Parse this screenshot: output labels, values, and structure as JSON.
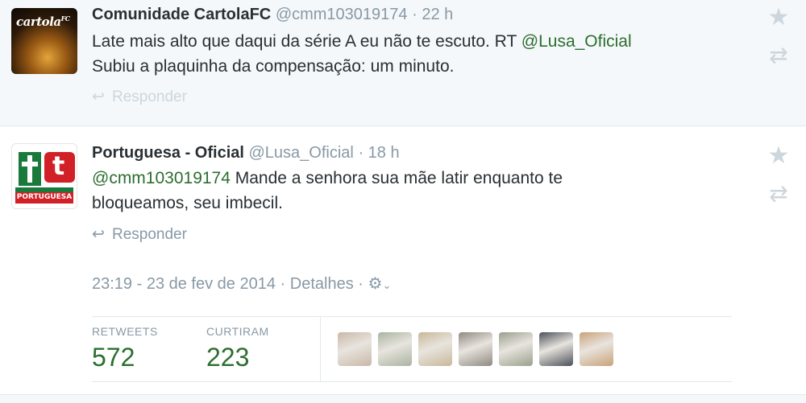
{
  "tweets": [
    {
      "avatar_text": "cartola",
      "avatar_sup": "FC",
      "fullname": "Comunidade CartolaFC",
      "handle": "@cmm103019174",
      "separator": "·",
      "time": "22 h",
      "body_line1_prefix": "Late mais alto que daqui da série A eu não te escuto. RT ",
      "body_line1_mention": "@Lusa_Oficial",
      "body_line2": "Subiu a plaquinha da compensação: um minuto.",
      "reply_label": "Responder"
    },
    {
      "avatar_caption": "PORTUGUESA",
      "fullname": "Portuguesa - Oficial",
      "handle": "@Lusa_Oficial",
      "separator": "·",
      "time": "18 h",
      "body_mention": "@cmm103019174",
      "body_line1_rest": " Mande a senhora sua mãe latir enquanto te",
      "body_line2": "bloqueamos, seu imbecil.",
      "reply_label": "Responder",
      "timestamp": "23:19 - 23 de fev de 2014",
      "meta_sep": "·",
      "details_label": "Detalhes",
      "stats": {
        "retweets_label": "RETWEETS",
        "retweets_value": "572",
        "favorites_label": "CURTIRAM",
        "favorites_value": "223"
      }
    }
  ],
  "icons": {
    "reply": "reply-arrow-icon",
    "star": "star-icon",
    "retweet": "retweet-icon",
    "gear": "gear-icon"
  },
  "favoriter_avatars": [
    {
      "color": "#c9b8a8"
    },
    {
      "color": "#a9b4a0"
    },
    {
      "color": "#c8b89a"
    },
    {
      "color": "#8f8a80"
    },
    {
      "color": "#9aa08c"
    },
    {
      "color": "#4a5058"
    },
    {
      "color": "#c9a27a"
    }
  ],
  "colors": {
    "link": "#2b7bb9",
    "mention": "#2c6e2f",
    "muted": "#8899a6",
    "count": "#2c6e2f"
  }
}
